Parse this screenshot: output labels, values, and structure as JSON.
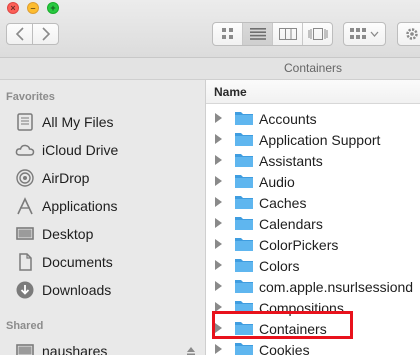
{
  "window": {
    "path_title": "Containers"
  },
  "toolbar": {
    "traffic": {
      "close": "×",
      "minimize": "–",
      "maximize": "+"
    },
    "back_icon": "chevron-left-icon",
    "forward_icon": "chevron-right-icon",
    "view_modes": [
      "icon-view",
      "list-view",
      "column-view",
      "cover-flow-view"
    ],
    "active_view": "list-view"
  },
  "sidebar": {
    "favorites_label": "Favorites",
    "favorites": [
      {
        "label": "All My Files",
        "icon": "all-files-icon"
      },
      {
        "label": "iCloud Drive",
        "icon": "cloud-icon"
      },
      {
        "label": "AirDrop",
        "icon": "airdrop-icon"
      },
      {
        "label": "Applications",
        "icon": "applications-icon"
      },
      {
        "label": "Desktop",
        "icon": "desktop-icon"
      },
      {
        "label": "Documents",
        "icon": "documents-icon"
      },
      {
        "label": "Downloads",
        "icon": "downloads-icon"
      }
    ],
    "shared_label": "Shared",
    "shared": [
      {
        "label": "naushares",
        "icon": "network-icon"
      }
    ]
  },
  "list": {
    "column_name": "Name",
    "rows": [
      "Accounts",
      "Application Support",
      "Assistants",
      "Audio",
      "Caches",
      "Calendars",
      "ColorPickers",
      "Colors",
      "com.apple.nsurlsessiond",
      "Compositions",
      "Containers",
      "Cookies"
    ],
    "highlighted": "Containers",
    "highlight_color": "#e8121c"
  },
  "colors": {
    "folder": "#5fb6ef",
    "folder_dark": "#3f9de0"
  }
}
